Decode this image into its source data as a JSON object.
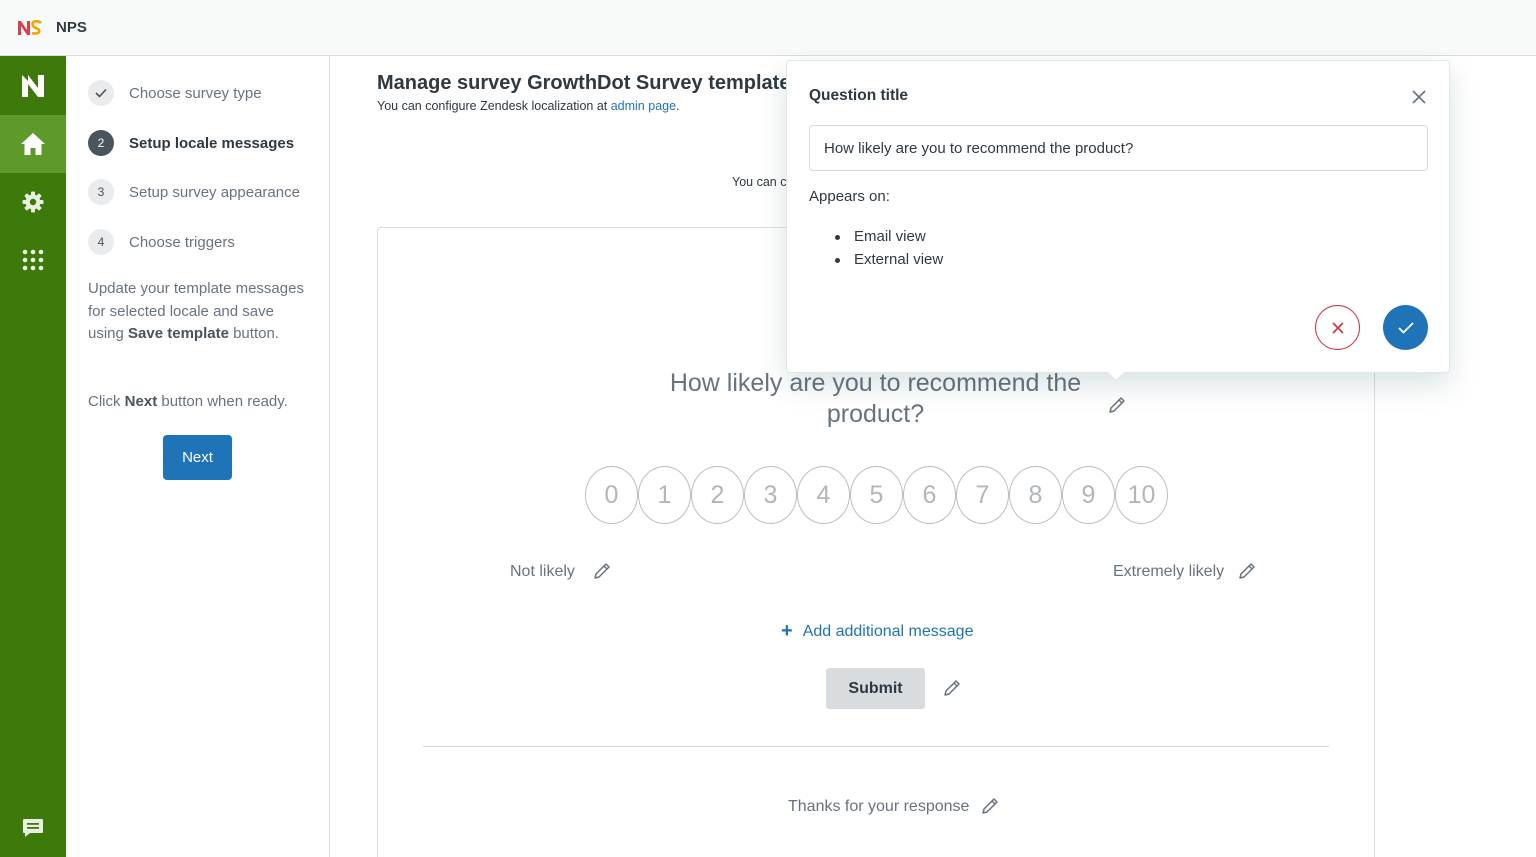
{
  "app": {
    "title": "NPS"
  },
  "steps": [
    {
      "number": "✓",
      "label": "Choose survey type"
    },
    {
      "number": "2",
      "label": "Setup locale messages"
    },
    {
      "number": "3",
      "label": "Setup survey appearance"
    },
    {
      "number": "4",
      "label": "Choose triggers"
    }
  ],
  "help": {
    "p1_a": "Update your template messages for selected locale and save using ",
    "p1_b": "Save template",
    "p1_c": " button.",
    "p2_a": "Click ",
    "p2_b": "Next",
    "p2_c": " button when ready."
  },
  "next_label": "Next",
  "main": {
    "title": "Manage survey GrowthDot Survey template",
    "subtitle_text": "You can configure Zendesk localization at ",
    "subtitle_link": "admin page",
    "subtitle_end": ".",
    "you_can": "You can c"
  },
  "survey": {
    "question": "How likely are you to recommend the product?",
    "scale": [
      "0",
      "1",
      "2",
      "3",
      "4",
      "5",
      "6",
      "7",
      "8",
      "9",
      "10"
    ],
    "label_low": "Not likely",
    "label_high": "Extremely likely",
    "add_message": "Add additional message",
    "submit": "Submit",
    "thanks": "Thanks for your response"
  },
  "popover": {
    "title": "Question title",
    "input_value": "How likely are you to recommend the product?",
    "appears_on": "Appears on:",
    "views": [
      "Email view",
      "External view"
    ]
  },
  "colors": {
    "rail": "#3e790b",
    "rail_active": "#5e9a2a",
    "primary": "#1f73b7",
    "danger": "#cc3340"
  }
}
